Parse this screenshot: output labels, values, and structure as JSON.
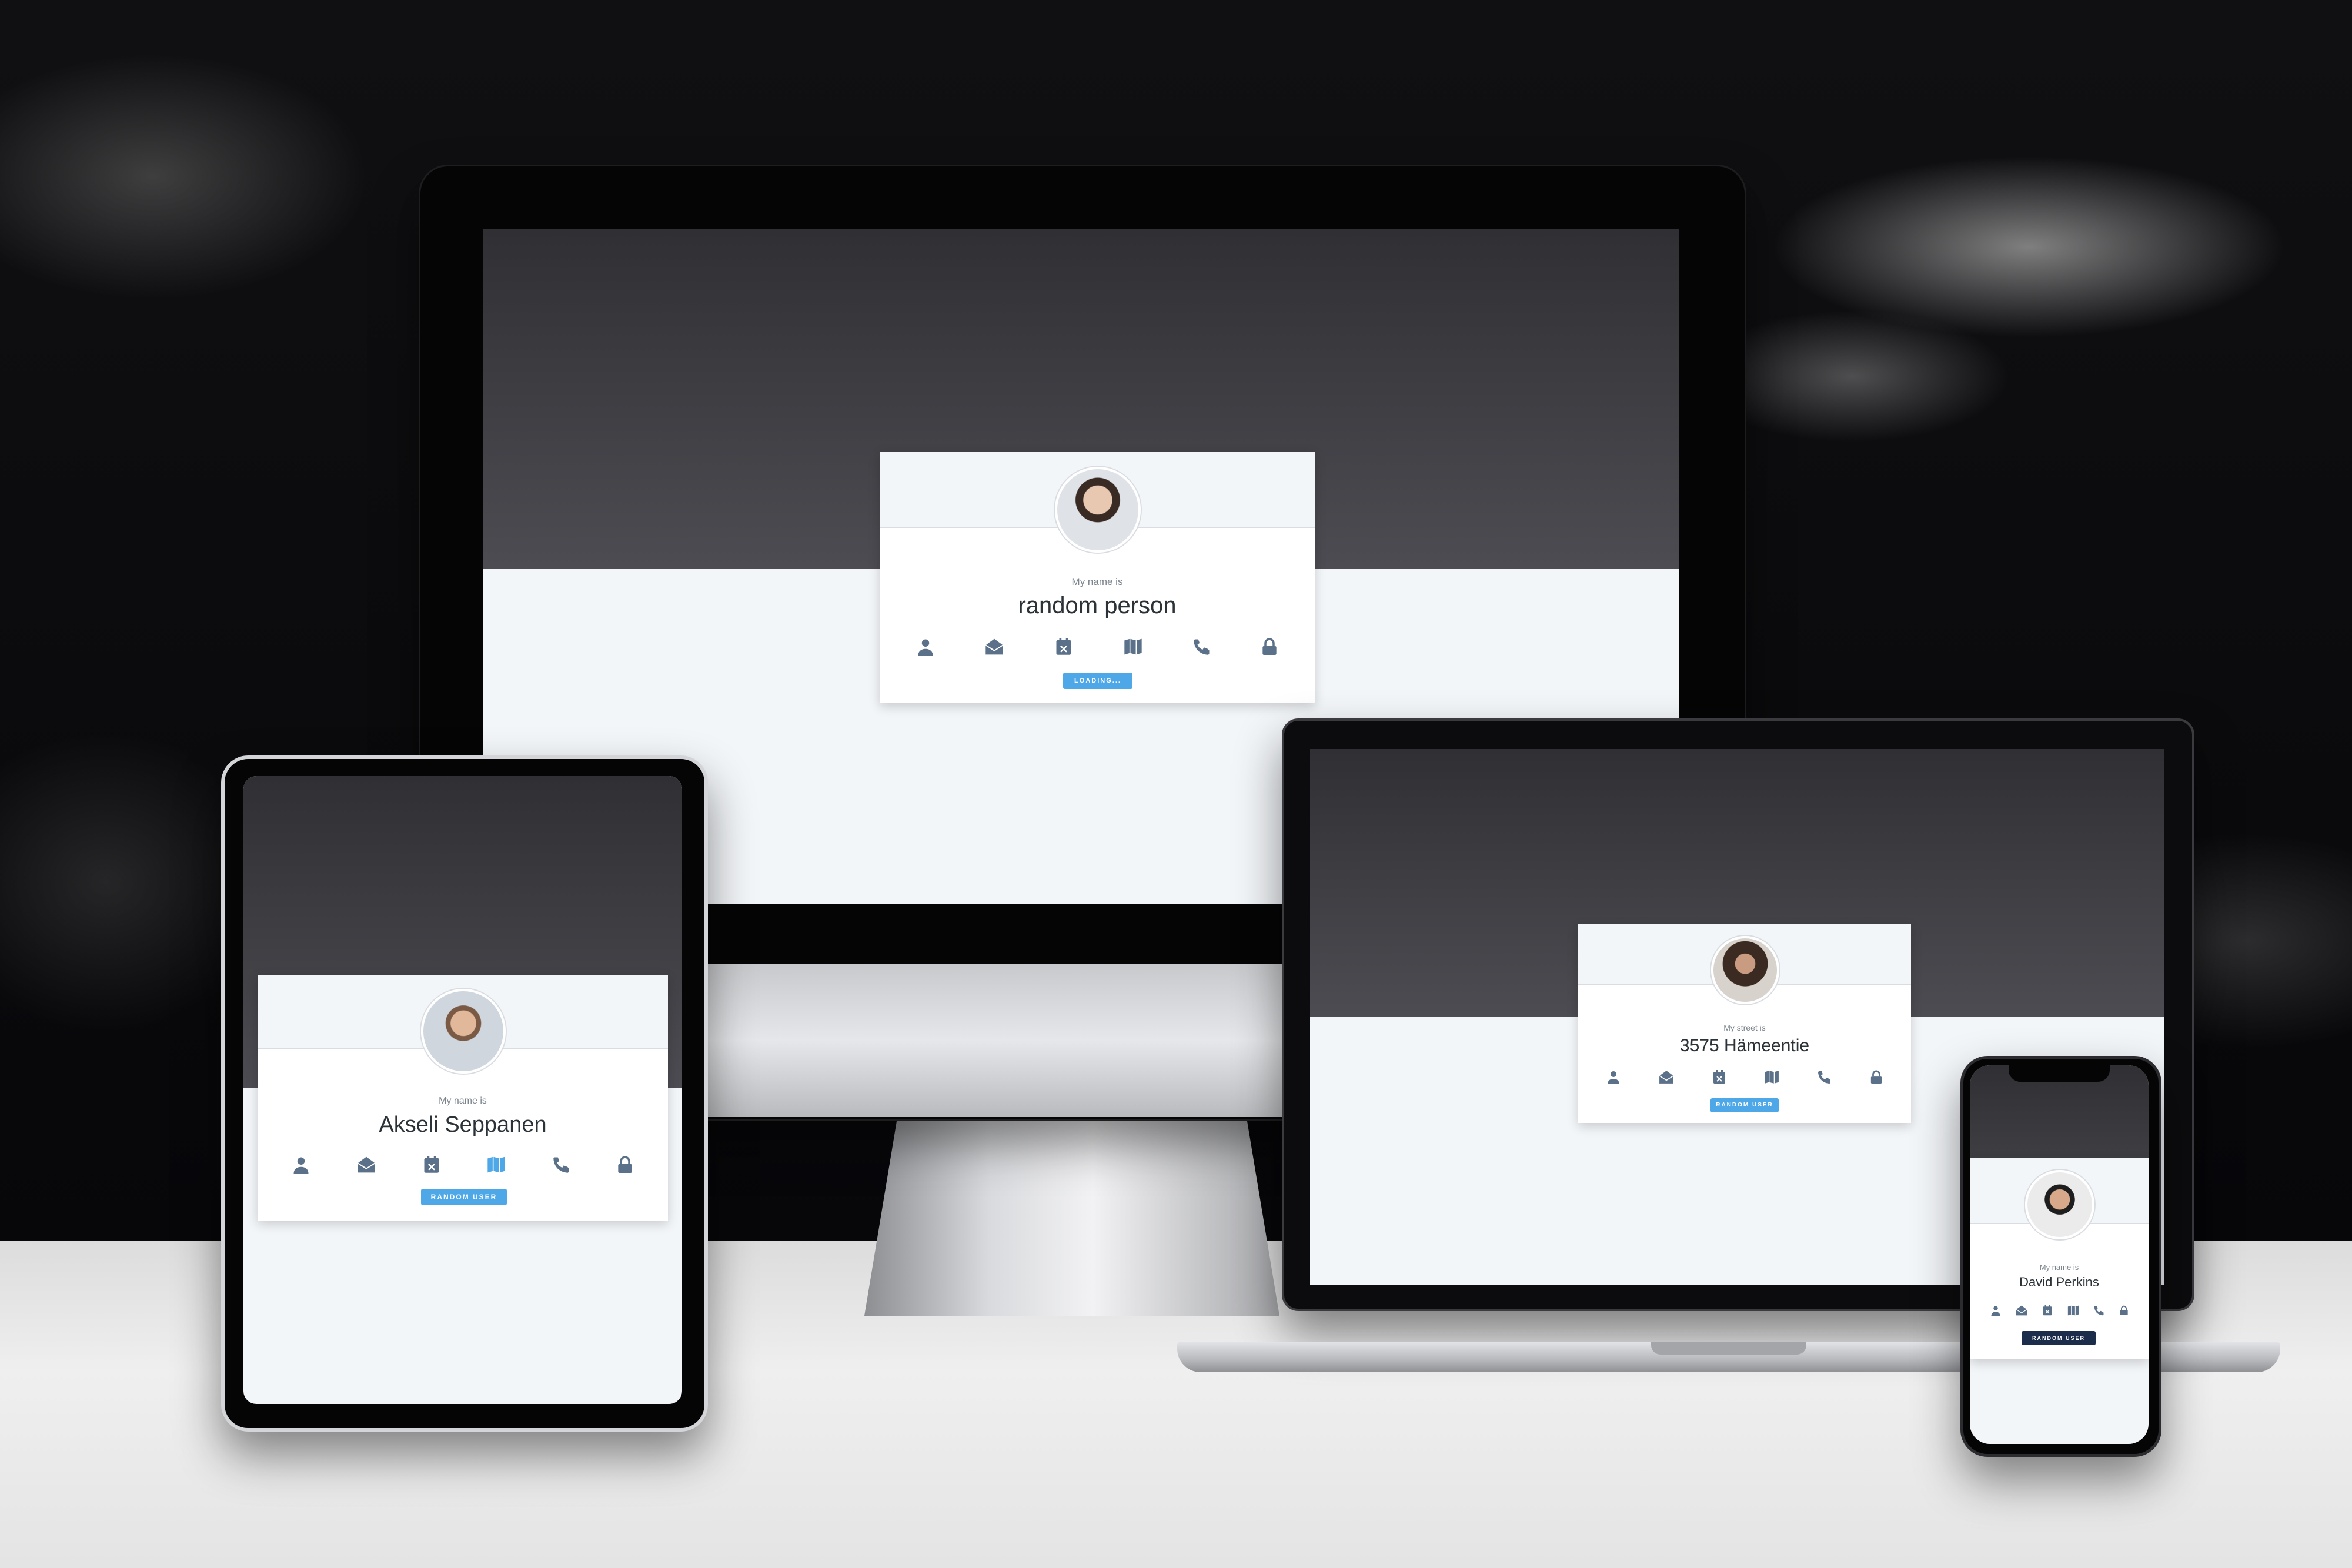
{
  "colors": {
    "header_dark": "#3a3a3f",
    "page_light": "#f3f6f9",
    "icon_gray": "#5b7089",
    "button_blue": "#4ea8e8",
    "button_navy": "#1b2d4b"
  },
  "desktop": {
    "card": {
      "label": "My name is",
      "value": "random person",
      "button": "LOADING..."
    },
    "icons": [
      "user-icon",
      "envelope-open-icon",
      "calendar-x-icon",
      "map-icon",
      "phone-icon",
      "lock-icon"
    ]
  },
  "laptop": {
    "card": {
      "label": "My street is",
      "value": "3575 Hämeentie",
      "button": "RANDOM USER"
    },
    "icons": [
      "user-icon",
      "envelope-open-icon",
      "calendar-x-icon",
      "map-icon",
      "phone-icon",
      "lock-icon"
    ]
  },
  "tablet": {
    "card": {
      "label": "My name is",
      "value": "Akseli Seppanen",
      "button": "RANDOM USER"
    },
    "icons": [
      "user-icon",
      "envelope-open-icon",
      "calendar-x-icon",
      "map-icon",
      "phone-icon",
      "lock-icon"
    ],
    "active_icon": "map-icon"
  },
  "phone": {
    "card": {
      "label": "My name is",
      "value": "David Perkins",
      "button": "RANDOM USER"
    },
    "icons": [
      "user-icon",
      "envelope-open-icon",
      "calendar-x-icon",
      "map-icon",
      "phone-icon",
      "lock-icon"
    ]
  }
}
